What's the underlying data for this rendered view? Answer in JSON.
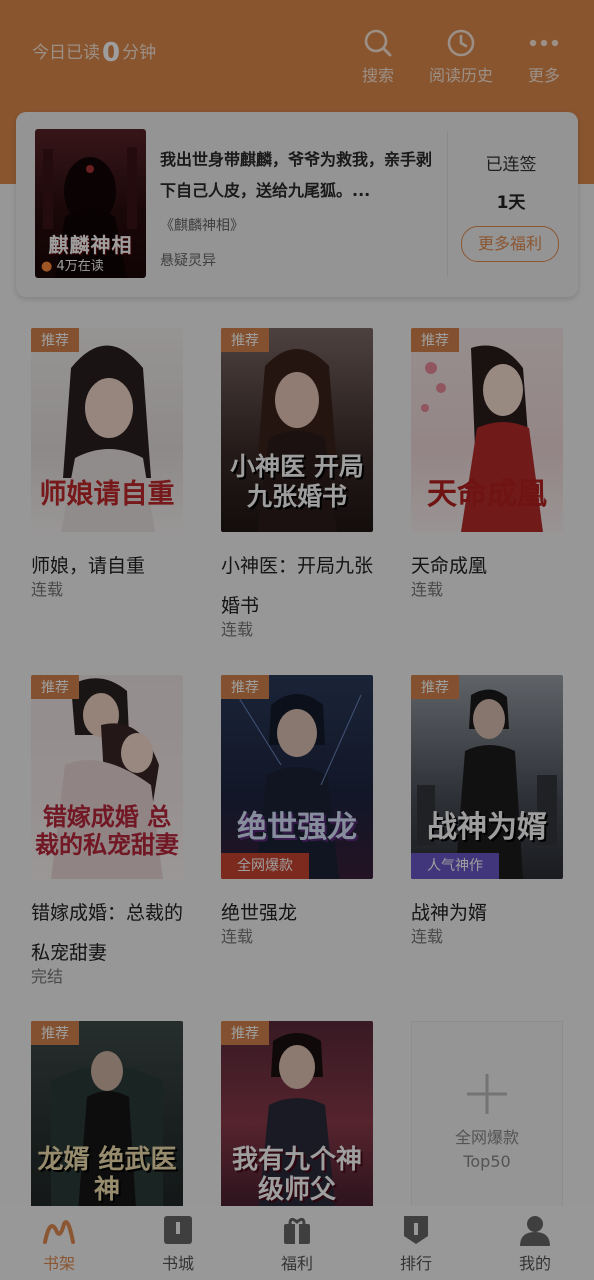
{
  "header": {
    "today_prefix": "今日已读",
    "today_minutes": "0",
    "today_suffix": "分钟",
    "buttons": [
      {
        "label": "搜索",
        "icon": "search-icon"
      },
      {
        "label": "阅读历史",
        "icon": "history-icon"
      },
      {
        "label": "更多",
        "icon": "more-icon"
      }
    ]
  },
  "featured": {
    "cover_title": "麒麟神相",
    "reading": "4万在读",
    "description": "我出世身带麒麟，爷爷为救我，亲手剥下自己人皮，送给九尾狐。...",
    "book_name": "《麒麟神相》",
    "category": "悬疑灵异",
    "signed_label": "已连签",
    "signed_days": "1天",
    "welfare_button": "更多福利"
  },
  "books": [
    {
      "tag": "推荐",
      "cover_title": "师娘请自重",
      "name": "师娘，请自重",
      "status": "连载"
    },
    {
      "tag": "推荐",
      "cover_title": "小神医 开局九张婚书",
      "name": "小神医：开局九张婚书",
      "status": "连载"
    },
    {
      "tag": "推荐",
      "cover_title": "天命成凰",
      "name": "天命成凰",
      "status": "连载"
    },
    {
      "tag": "推荐",
      "cover_title": "错嫁成婚 总裁的私宠甜妻",
      "name": "错嫁成婚：总裁的私宠甜妻",
      "status": "完结"
    },
    {
      "tag": "推荐",
      "cover_title": "绝世强龙",
      "strip": "全网爆款",
      "name": "绝世强龙",
      "status": "连载"
    },
    {
      "tag": "推荐",
      "cover_title": "战神为婿",
      "strip": "人气神作",
      "name": "战神为婿",
      "status": "连载"
    },
    {
      "tag": "推荐",
      "cover_title": "龙婿 绝武医神"
    },
    {
      "tag": "推荐",
      "cover_title": "我有九个神级师父"
    }
  ],
  "add_tile": {
    "line1": "全网爆款",
    "line2": "Top50"
  },
  "tabs": [
    {
      "label": "书架",
      "icon": "bookshelf-icon",
      "active": true
    },
    {
      "label": "书城",
      "icon": "bookstore-icon"
    },
    {
      "label": "福利",
      "icon": "gift-icon"
    },
    {
      "label": "排行",
      "icon": "ranking-icon"
    },
    {
      "label": "我的",
      "icon": "profile-icon"
    }
  ],
  "colors": {
    "accent": "#e08b51",
    "header": "#dd8a4d",
    "tag": "#d4844e"
  }
}
